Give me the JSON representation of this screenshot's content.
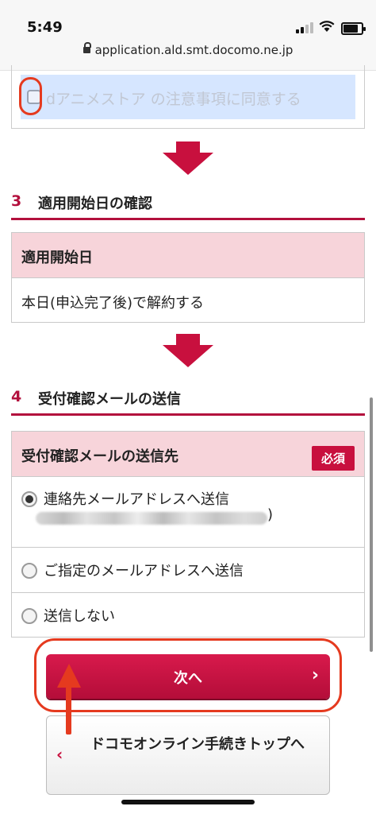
{
  "status": {
    "time": "5:49"
  },
  "browser": {
    "url": "application.ald.smt.docomo.ne.jp"
  },
  "agreement": {
    "text": "dアニメストア の注意事項に同意する",
    "checked": false
  },
  "section3": {
    "number": "3",
    "title": "適用開始日の確認",
    "field_label": "適用開始日",
    "field_value": "本日(申込完了後)で解約する"
  },
  "section4": {
    "number": "4",
    "title": "受付確認メールの送信",
    "field_label": "受付確認メールの送信先",
    "required_badge": "必須",
    "options": [
      {
        "label": "連絡先メールアドレスへ送信",
        "selected": true,
        "suffix": ")"
      },
      {
        "label": "ご指定のメールアドレスへ送信",
        "selected": false
      },
      {
        "label": "送信しない",
        "selected": false
      }
    ]
  },
  "buttons": {
    "next_label": "次へ",
    "next_chevron": "›",
    "top_label": "ドコモオンライン手続きトップへ",
    "top_chevron": "‹"
  },
  "colors": {
    "brand": "#c8103e",
    "annotation": "#e53a1f",
    "pink_header": "#f7d4da",
    "agree_bg": "#d6e6ff"
  }
}
